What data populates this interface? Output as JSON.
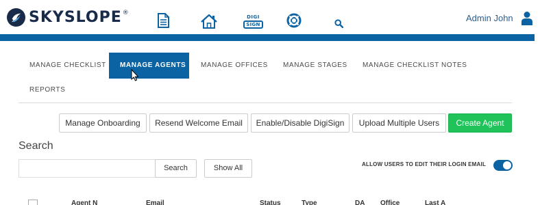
{
  "header": {
    "brand": "SKYSLOPE",
    "trademark": "®",
    "nav_icons": [
      "document-icon",
      "home-icon",
      "digisign-icon",
      "lifebuoy-icon",
      "search-icon"
    ],
    "digisign_top": "DIGI",
    "digisign_bottom": "SIGN",
    "user_name": "Admin John",
    "colors": {
      "brand_blue": "#0b63a4",
      "logo_dark": "#1a2b49"
    }
  },
  "tabs": [
    {
      "label": "MANAGE CHECKLIST",
      "active": false
    },
    {
      "label": "MANAGE AGENTS",
      "active": true
    },
    {
      "label": "MANAGE OFFICES",
      "active": false
    },
    {
      "label": "MANAGE STAGES",
      "active": false
    },
    {
      "label": "MANAGE CHECKLIST NOTES",
      "active": false
    },
    {
      "label": "REPORTS",
      "active": false
    }
  ],
  "actions": {
    "manage_onboarding": "Manage Onboarding",
    "resend_welcome_email": "Resend Welcome Email",
    "enable_disable_digisign": "Enable/Disable DigiSign",
    "upload_multiple_users": "Upload Multiple Users",
    "create_agent": "Create Agent",
    "create_agent_color": "#1fc35a"
  },
  "search": {
    "heading": "Search",
    "input_value": "",
    "input_placeholder": "",
    "search_button": "Search",
    "show_all_button": "Show All"
  },
  "settings": {
    "allow_edit_login_email_label": "ALLOW USERS TO EDIT THEIR LOGIN EMAIL",
    "allow_edit_login_email_on": true
  },
  "table": {
    "columns": [
      "Agent N",
      "Email",
      "Status",
      "Type",
      "DA",
      "Office",
      "Last A"
    ]
  }
}
